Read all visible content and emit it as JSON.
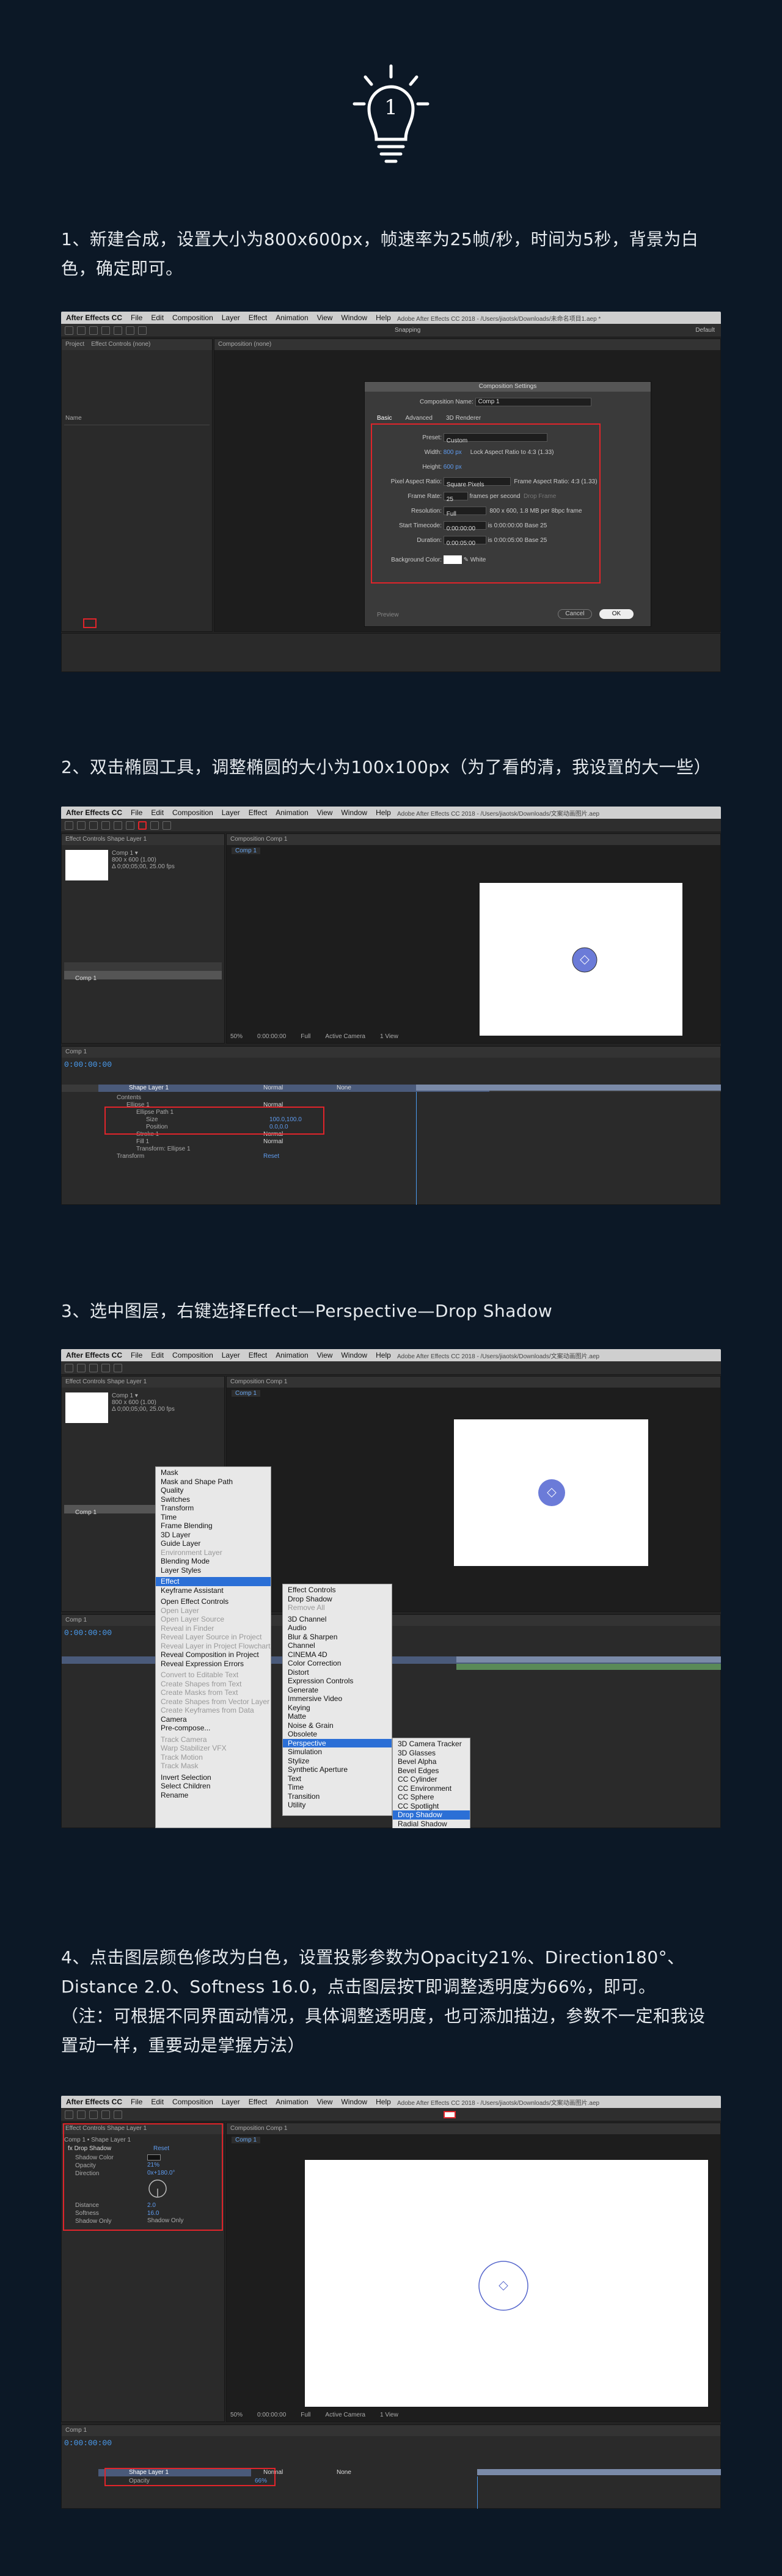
{
  "icon_number": "1",
  "steps": [
    {
      "text": "1、新建合成，设置大小为800x600px，帧速率为25帧/秒，时间为5秒，背景为白色，确定即可。"
    },
    {
      "text": "2、双击椭圆工具，调整椭圆的大小为100x100px（为了看的清，我设置的大一些）"
    },
    {
      "text": "3、选中图层，右键选择Effect—Perspective—Drop Shadow"
    },
    {
      "text": "4、点击图层颜色修改为白色，设置投影参数为Opacity21%、Direction180°、Distance 2.0、Softness 16.0，点击图层按T即调整透明度为66%，即可。"
    },
    {
      "text": "（注：可根据不同界面动情况，具体调整透明度，也可添加描边，参数不一定和我设置动一样，重要动是掌握方法）"
    }
  ],
  "menubar": {
    "app": "After Effects CC",
    "items": [
      "File",
      "Edit",
      "Composition",
      "Layer",
      "Effect",
      "Animation",
      "View",
      "Window",
      "Help"
    ],
    "title1": "Adobe After Effects CC 2018 - /Users/jiaotsk/Downloads/未命名项目1.aep *",
    "title2": "Adobe After Effects CC 2018 - /Users/jiaotsk/Downloads/文案动画图片.aep"
  },
  "shot1": {
    "project_tab": "Project",
    "effect_tab": "Effect Controls (none)",
    "comp_tab": "Composition (none)",
    "snapping": "Snapping",
    "default": "Default",
    "name_col": "Name",
    "dialog": {
      "title": "Composition Settings",
      "comp_name_label": "Composition Name:",
      "comp_name": "Comp 1",
      "tabs": [
        "Basic",
        "Advanced",
        "3D Renderer"
      ],
      "preset_label": "Preset:",
      "preset": "Custom",
      "width_label": "Width:",
      "width": "800 px",
      "height_label": "Height:",
      "height": "600 px",
      "lock_label": "Lock Aspect Ratio to 4:3 (1.33)",
      "par_label": "Pixel Aspect Ratio:",
      "par": "Square Pixels",
      "far_label": "Frame Aspect Ratio:",
      "far": "4:3 (1.33)",
      "fps_label": "Frame Rate:",
      "fps": "25",
      "fps_unit": "frames per second",
      "drop": "Drop Frame",
      "res_label": "Resolution:",
      "res": "Full",
      "res_info": "800 x 600, 1.8 MB per 8bpc frame",
      "start_label": "Start Timecode:",
      "start": "0:00:00:00",
      "start_info": "is 0:00:00:00  Base 25",
      "dur_label": "Duration:",
      "dur": "0:00:05:00",
      "dur_info": "is 0:00:05:00  Base 25",
      "bg_label": "Background Color:",
      "bg": "White",
      "preview": "Preview",
      "cancel": "Cancel",
      "ok": "OK"
    }
  },
  "shot2": {
    "effect_tab": "Effect Controls Shape Layer 1",
    "comp_tab": "Composition Comp 1",
    "comp_sub": "Comp 1",
    "comp_info": "Comp 1 ▾\n800 x 600 (1.00)\nΔ 0;00;05;00, 25.00 fps",
    "layer_name": "Comp 1",
    "timecode": "0:00:00:00",
    "zoom": "50%",
    "view": "Full",
    "camera": "Active Camera",
    "views": "1 View",
    "layer1": "Shape Layer 1",
    "rows": [
      "Contents",
      "Ellipse 1",
      "Ellipse Path 1",
      "Size",
      "Position",
      "Stroke 1",
      "Fill 1",
      "Transform: Ellipse 1",
      "Transform"
    ],
    "size_val": "100.0,100.0",
    "pos_val": "0.0,0.0",
    "normal": "Normal",
    "reset": "Reset",
    "none": "None"
  },
  "shot3": {
    "context_menu": [
      "Mask",
      "Mask and Shape Path",
      "Quality",
      "Switches",
      "Transform",
      "Time",
      "Frame Blending",
      "3D Layer",
      "Guide Layer",
      "Environment Layer",
      "Blending Mode",
      "Layer Styles",
      "Effect",
      "Keyframe Assistant",
      "Open Effect Controls",
      "Open Layer",
      "Open Layer Source",
      "Reveal in Finder",
      "Reveal Layer Source in Project",
      "Reveal Layer in Project Flowchart",
      "Reveal Composition in Project",
      "Reveal Expression Errors",
      "Convert to Editable Text",
      "Create Shapes from Text",
      "Create Masks from Text",
      "Create Shapes from Vector Layer",
      "Create Keyframes from Data",
      "Camera",
      "Pre-compose...",
      "Track Camera",
      "Warp Stabilizer VFX",
      "Track Motion",
      "Track Mask",
      "Invert Selection",
      "Select Children",
      "Rename"
    ],
    "effect_menu": [
      "Effect Controls",
      "Drop Shadow",
      "Remove All",
      "3D Channel",
      "Audio",
      "Blur & Sharpen",
      "Channel",
      "CINEMA 4D",
      "Color Correction",
      "Distort",
      "Expression Controls",
      "Generate",
      "Immersive Video",
      "Keying",
      "Matte",
      "Noise & Grain",
      "Obsolete",
      "Perspective",
      "Simulation",
      "Stylize",
      "Synthetic Aperture",
      "Text",
      "Time",
      "Transition",
      "Utility"
    ],
    "persp_menu": [
      "3D Camera Tracker",
      "3D Glasses",
      "Bevel Alpha",
      "Bevel Edges",
      "CC Cylinder",
      "CC Environment",
      "CC Sphere",
      "CC Spotlight",
      "Drop Shadow",
      "Radial Shadow"
    ]
  },
  "shot4": {
    "effect_title": "Effect Controls Shape Layer 1",
    "layer_title": "Comp 1 • Shape Layer 1",
    "fx_name": "Drop Shadow",
    "reset": "Reset",
    "params": [
      {
        "name": "Shadow Color",
        "value": ""
      },
      {
        "name": "Opacity",
        "value": "21%"
      },
      {
        "name": "Direction",
        "value": "0x+180.0°"
      },
      {
        "name": "Distance",
        "value": "2.0"
      },
      {
        "name": "Softness",
        "value": "16.0"
      },
      {
        "name": "Shadow Only",
        "value": "Shadow Only"
      }
    ],
    "layer1": "Shape Layer 1",
    "opacity_row": "Opacity",
    "opacity_val": "66%"
  }
}
